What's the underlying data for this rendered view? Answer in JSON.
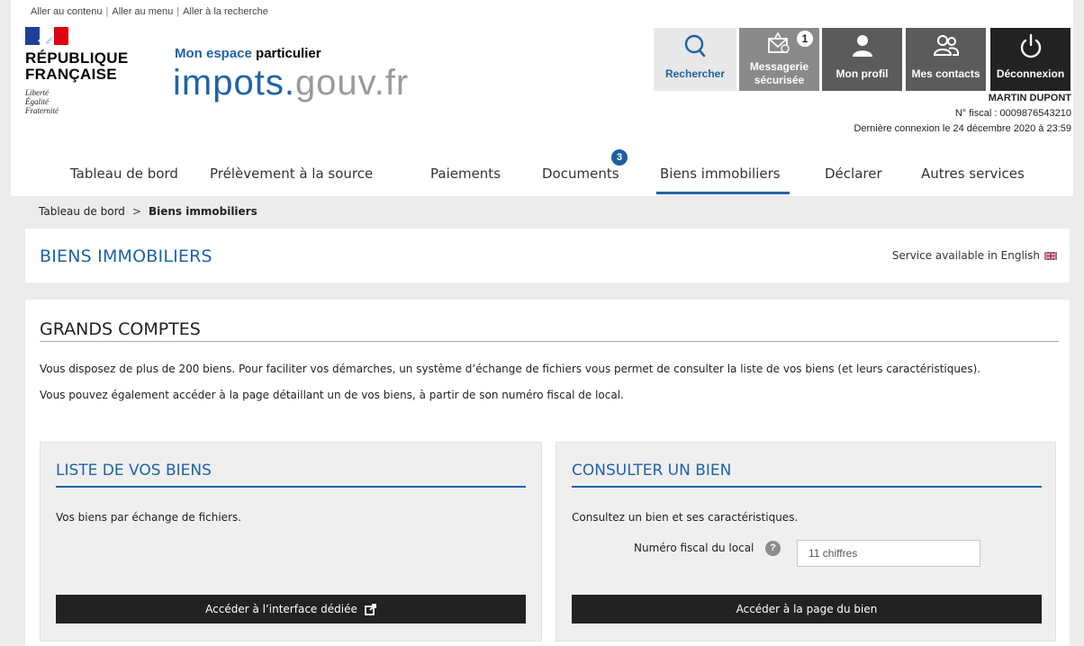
{
  "skiplinks": [
    "Aller au contenu",
    "Aller au menu",
    "Aller à la recherche"
  ],
  "rf": {
    "name_line1": "RÉPUBLIQUE",
    "name_line2": "FRANÇAISE",
    "motto": [
      "Liberté",
      "Égalité",
      "Fraternité"
    ]
  },
  "brand": {
    "sub_pre": "Mon espace",
    "sub_post": " particulier",
    "main": "impots.",
    "tld": "gouv.fr",
    "color": "#1f63a8"
  },
  "tools": {
    "search": "Rechercher",
    "msg_line1": "Messagerie",
    "msg_line2": "sécurisée",
    "msg_badge": "1",
    "profile": "Mon profil",
    "contacts": "Mes contacts",
    "logout": "Déconnexion"
  },
  "user": {
    "name": "MARTIN DUPONT",
    "fiscal": "N° fiscal : 0009876543210",
    "last_login": "Dernière connexion le 24 décembre 2020 à 23:59"
  },
  "nav": {
    "items": [
      "Tableau de bord",
      "Prélèvement à la source",
      "Paiements",
      "Documents",
      "Biens immobiliers",
      "Déclarer",
      "Autres services"
    ],
    "active": "Biens immobiliers",
    "documents_badge": "3"
  },
  "breadcrumb": {
    "home": "Tableau de bord",
    "separator": ">",
    "current": "Biens immobiliers"
  },
  "page": {
    "title": "BIENS IMMOBILIERS",
    "english": "Service available in English"
  },
  "section": {
    "title": "GRANDS COMPTES",
    "p1": "Vous disposez de plus de 200 biens. Pour faciliter vos démarches, un système d’échange de fichiers vous permet de consulter la liste de vos biens (et leurs caractéristiques).",
    "p2": "Vous pouvez également accéder à la page détaillant un de vos biens, à partir de son numéro fiscal de local."
  },
  "cards": {
    "list": {
      "title": "LISTE DE VOS BIENS",
      "text": "Vos biens par échange de fichiers.",
      "button": "Accéder à l’interface dédiée"
    },
    "consult": {
      "title": "CONSULTER UN BIEN",
      "text": "Consultez un bien et ses caractéristiques.",
      "field_label": "Numéro fiscal du local",
      "help": "?",
      "placeholder": "11 chiffres",
      "button": "Accéder à la page du bien"
    }
  }
}
